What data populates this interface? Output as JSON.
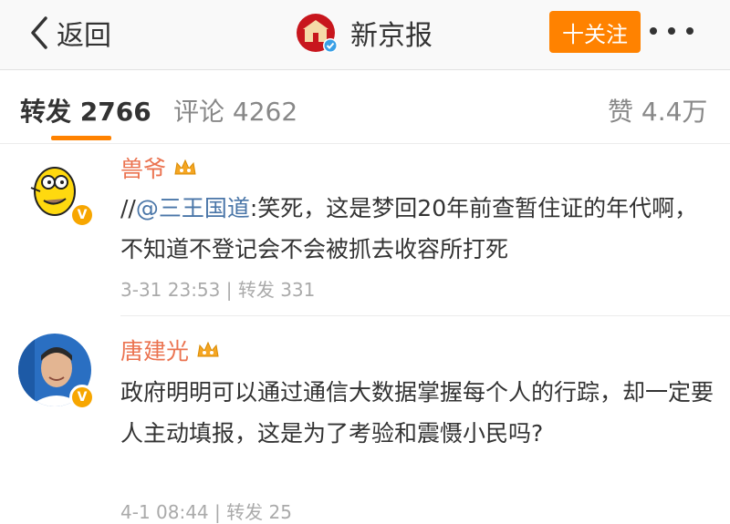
{
  "header": {
    "back_label": "返回",
    "account_name": "新京报",
    "follow_label": "十关注"
  },
  "tabs": {
    "repost": "转发 2766",
    "comments": "评论 4262",
    "likes": "赞 4.4万"
  },
  "reposts": [
    {
      "user": "兽爷",
      "prefix": "//",
      "mention": "@三王国道",
      "text": ":笑死，这是梦回20年前查暂住证的年代啊，不知道不登记会不会被抓去收容所打死",
      "meta": "3-31 23:53 | 转发 331"
    },
    {
      "user": "唐建光",
      "text": "政府明明可以通过通信大数据掌握每个人的行踪，却一定要人主动填报，这是为了考验和震慑小民吗?",
      "meta": "4-1 08:44 | 转发 25"
    }
  ],
  "colors": {
    "accent": "#ff8200",
    "username": "#eb7350",
    "mention": "#4a76a8",
    "verified_badge": "#f7a600"
  },
  "icons": [
    "back-chevron-icon",
    "newspaper-logo",
    "verified-icon",
    "more-dots-icon",
    "crown-icon"
  ]
}
